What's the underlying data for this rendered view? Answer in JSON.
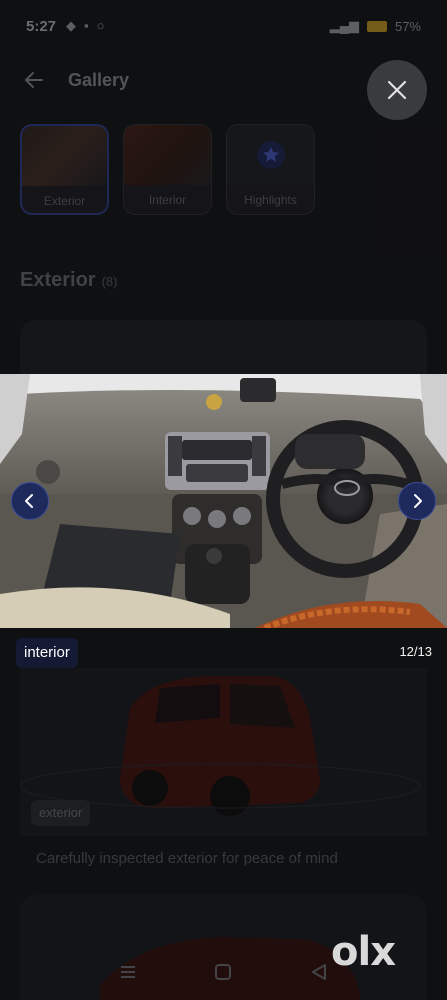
{
  "status_bar": {
    "time": "5:27",
    "battery": "57%"
  },
  "header": {
    "title": "Gallery"
  },
  "thumbnails": [
    {
      "label": "Exterior",
      "active": true
    },
    {
      "label": "Interior",
      "active": false
    },
    {
      "label": "Highlights",
      "active": false
    }
  ],
  "section": {
    "title": "Exterior",
    "count": "(8)"
  },
  "viewer": {
    "caption": "interior",
    "counter": "12/13"
  },
  "exterior_card": {
    "badge": "exterior",
    "description": "Carefully inspected exterior for peace of mind"
  },
  "brand": {
    "logo": "olx"
  },
  "colors": {
    "accent": "#1f2a5c",
    "background": "#151619"
  },
  "icons": [
    "back-arrow-icon",
    "close-icon",
    "chevron-left-icon",
    "chevron-right-icon",
    "star-icon",
    "menu-icon",
    "home-icon",
    "back-icon"
  ]
}
